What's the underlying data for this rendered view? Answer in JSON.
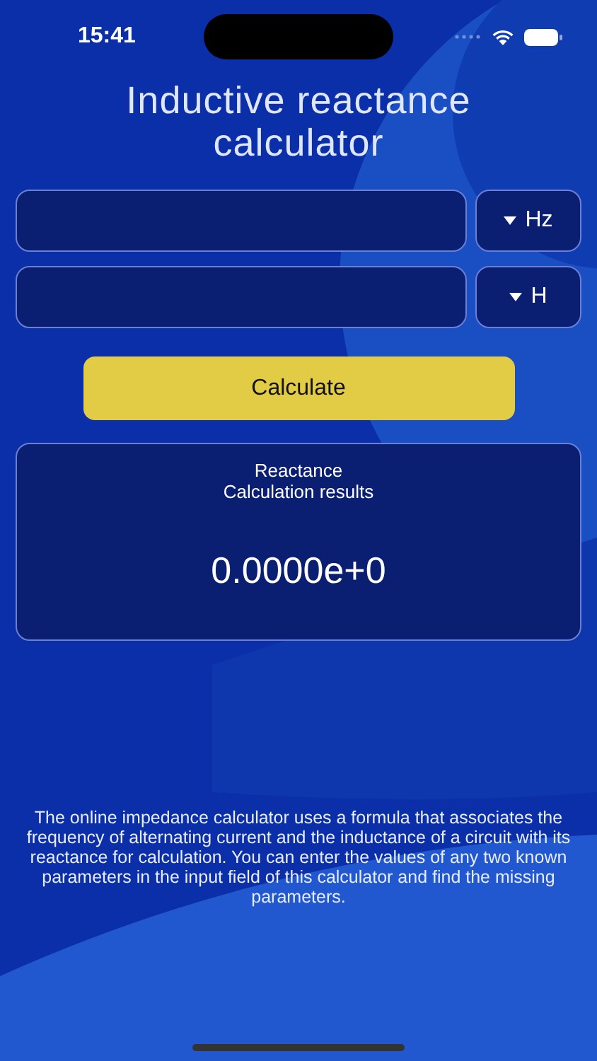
{
  "status_bar": {
    "time": "15:41"
  },
  "title": "Inductive reactance calculator",
  "inputs": [
    {
      "unit": "Hz"
    },
    {
      "unit": "H"
    }
  ],
  "calculate_button": "Calculate",
  "result": {
    "title": "Reactance",
    "subtitle": "Calculation results",
    "value": "0.0000e+0"
  },
  "description": "The online impedance calculator uses a formula that associates the frequency of alternating current and the inductance of a circuit with its reactance for calculation. You can enter the values of any two known parameters in the input field of this calculator and find the missing parameters."
}
